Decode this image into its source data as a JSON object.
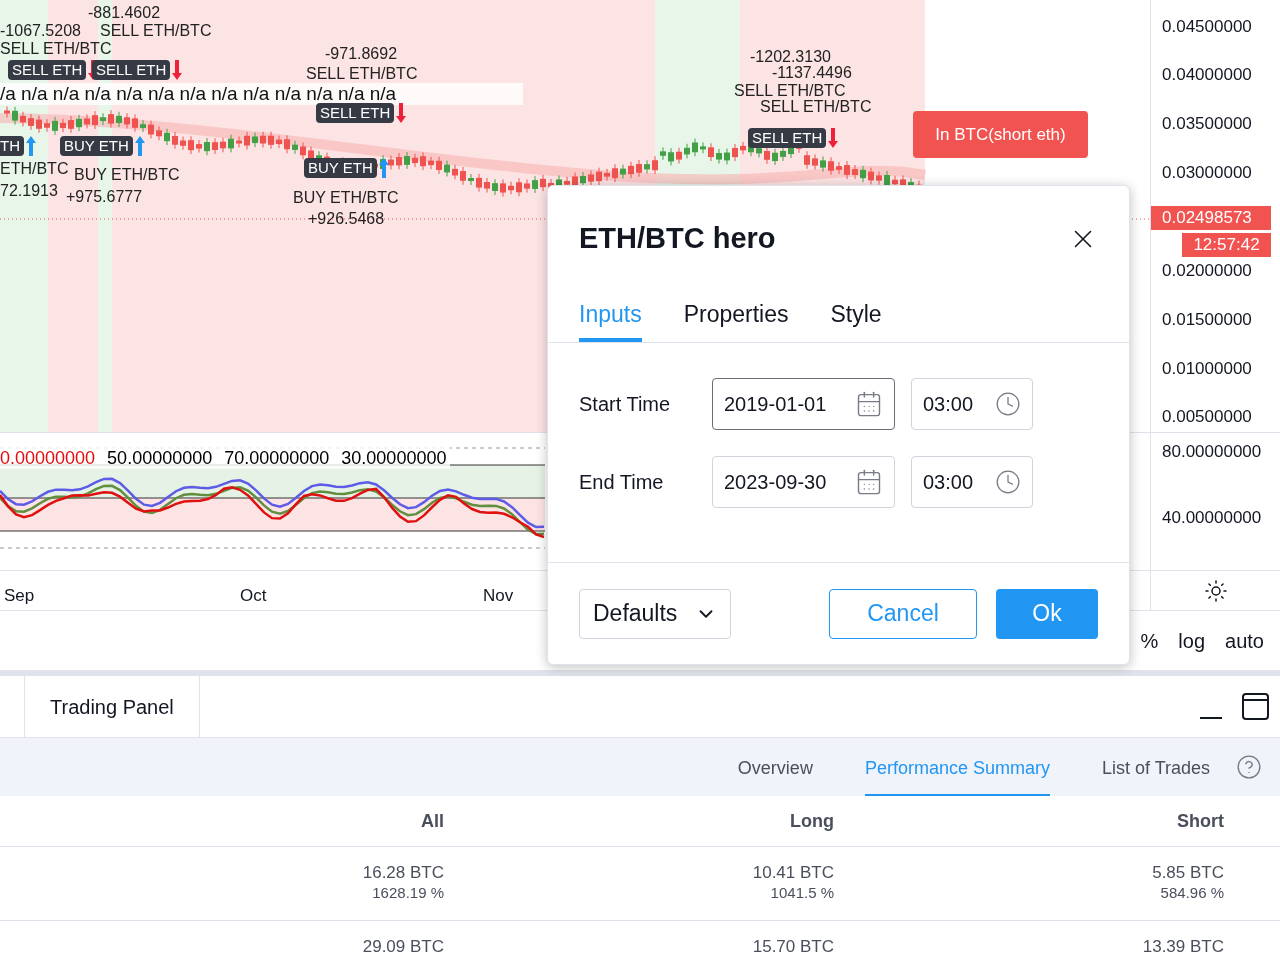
{
  "chart": {
    "annotations": [
      {
        "kind": "label",
        "text": "-881.4602"
      },
      {
        "kind": "label",
        "text": "-1067.5208"
      },
      {
        "kind": "label",
        "text": "SELL ETH/BTC"
      },
      {
        "kind": "label",
        "text": "SELL ETH/BTC"
      },
      {
        "kind": "sell",
        "text": "SELL ETH"
      },
      {
        "kind": "sell",
        "text": "SELL ETH"
      },
      {
        "kind": "buy",
        "text": "TH"
      },
      {
        "kind": "buy",
        "text": "BUY ETH"
      },
      {
        "kind": "label",
        "text": "ETH/BTC"
      },
      {
        "kind": "label",
        "text": "BUY ETH/BTC"
      },
      {
        "kind": "label",
        "text": "72.1913"
      },
      {
        "kind": "label",
        "text": "+975.6777"
      },
      {
        "kind": "label",
        "text": "-971.8692"
      },
      {
        "kind": "label",
        "text": "SELL ETH/BTC"
      },
      {
        "kind": "sell",
        "text": "SELL ETH"
      },
      {
        "kind": "buy",
        "text": "BUY ETH"
      },
      {
        "kind": "label",
        "text": "BUY ETH/BTC"
      },
      {
        "kind": "label",
        "text": "+926.5468"
      },
      {
        "kind": "label",
        "text": "-1202.3130"
      },
      {
        "kind": "label",
        "text": "-1137.4496"
      },
      {
        "kind": "label",
        "text": "SELL ETH/BTC"
      },
      {
        "kind": "label",
        "text": "SELL ETH/BTC"
      },
      {
        "kind": "sell",
        "text": "SELL ETH"
      }
    ],
    "na_row": "/a n/a n/a n/a n/a n/a n/a n/a n/a n/a n/a n/a n/a",
    "position_label": "In BTC(short eth)",
    "price_ticks": [
      "0.04500000",
      "0.04000000",
      "0.03500000",
      "0.03000000",
      "0.02000000",
      "0.01500000",
      "0.01000000",
      "0.00500000"
    ],
    "last_price": "0.02498573",
    "countdown": "12:57:42",
    "oscillator_labels": [
      {
        "text": "0.00000000",
        "color": "#e01010"
      },
      {
        "text": "50.00000000",
        "color": "#000000"
      },
      {
        "text": "70.00000000",
        "color": "#000000"
      },
      {
        "text": "30.00000000",
        "color": "#000000"
      }
    ],
    "oscillator_ticks": [
      "80.00000000",
      "40.00000000"
    ],
    "time_labels": [
      "Sep",
      "Oct",
      "Nov"
    ],
    "scale_buttons": [
      "%",
      "log",
      "auto"
    ]
  },
  "dialog": {
    "title": "ETH/BTC hero",
    "tabs": [
      {
        "label": "Inputs",
        "selected": true
      },
      {
        "label": "Properties",
        "selected": false
      },
      {
        "label": "Style",
        "selected": false
      }
    ],
    "fields": [
      {
        "label": "Start Time",
        "date": "2019-01-01",
        "time": "03:00",
        "focused": true
      },
      {
        "label": "End Time",
        "date": "2023-09-30",
        "time": "03:00",
        "focused": false
      }
    ],
    "defaults_button": "Defaults",
    "cancel_button": "Cancel",
    "ok_button": "Ok"
  },
  "trading_panel": {
    "tab": "Trading Panel",
    "tabs": [
      {
        "label": "Overview",
        "selected": false
      },
      {
        "label": "Performance Summary",
        "selected": true
      },
      {
        "label": "List of Trades",
        "selected": false
      }
    ],
    "columns": [
      "All",
      "Long",
      "Short"
    ],
    "rows": [
      {
        "cells": [
          {
            "value": "16.28 BTC",
            "percent": "1628.19 %"
          },
          {
            "value": "10.41 BTC",
            "percent": "1041.5 %"
          },
          {
            "value": "5.85 BTC",
            "percent": "584.96 %"
          }
        ]
      },
      {
        "cells": [
          {
            "value": "29.09 BTC"
          },
          {
            "value": "15.70 BTC"
          },
          {
            "value": "13.39 BTC"
          }
        ]
      }
    ]
  }
}
